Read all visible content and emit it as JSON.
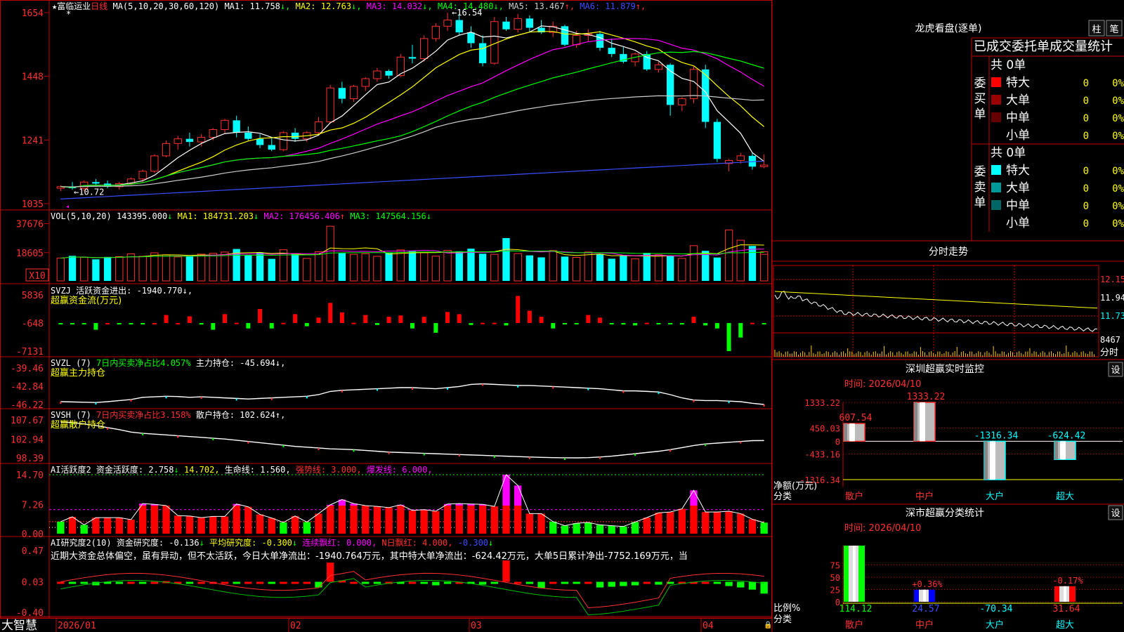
{
  "stock": {
    "name": "富临运业",
    "period": "日线",
    "ma_header": "MA(5,10,20,30,60,120)",
    "ma_values": [
      {
        "label": "MA1: 11.758",
        "arrow": "↓",
        "color": "#ffffff",
        "arrow_color": "#00ff00"
      },
      {
        "label": "MA2: 12.763",
        "arrow": "↓",
        "color": "#ffff00",
        "arrow_color": "#00ff00"
      },
      {
        "label": "MA3: 14.032",
        "arrow": "↓",
        "color": "#ff00ff",
        "arrow_color": "#00ff00"
      },
      {
        "label": "MA4: 14.480",
        "arrow": "↓",
        "color": "#00ff00",
        "arrow_color": "#00ff00"
      },
      {
        "label": "MA5: 13.467",
        "arrow": "↑",
        "color": "#cccccc",
        "arrow_color": "#ff3030"
      },
      {
        "label": "MA6: 11.879",
        "arrow": "↑",
        "color": "#3a4dff",
        "arrow_color": "#ff3030"
      }
    ],
    "high_label": "16.54",
    "low_label": "10.72"
  },
  "axes": {
    "main": [
      "1654",
      "1448",
      "1241",
      "1035"
    ],
    "vol": [
      "37676",
      "18605"
    ],
    "vol_unit": "X10",
    "svzj": [
      "5836",
      "-648",
      "-7131"
    ],
    "svzl": [
      "-39.46",
      "-42.84",
      "-46.22"
    ],
    "svsh": [
      "107.67",
      "102.94",
      "98.39"
    ],
    "ai1": [
      "14.70",
      "7.26",
      "0.00"
    ],
    "ai2": [
      "0.47",
      "0.03",
      "-0.40"
    ],
    "dates": [
      "2026/01",
      "02",
      "03",
      "04"
    ]
  },
  "panels": {
    "vol": {
      "header": "VOL(5,10,20)",
      "parts": [
        {
          "t": "143395.000",
          "c": "#ffffff",
          "a": "↓",
          "ac": "#00ff00"
        },
        {
          "t": "MA1: 184731.203",
          "c": "#ffff00",
          "a": "↓",
          "ac": "#00ff00"
        },
        {
          "t": "MA2: 176456.406",
          "c": "#ff00ff",
          "a": "↑",
          "ac": "#ff3030"
        },
        {
          "t": "MA3: 147564.156",
          "c": "#00ff00",
          "a": "↓",
          "ac": "#00ff00"
        }
      ]
    },
    "svzj": {
      "header": "SVZJ",
      "label": "活跃资金进出: -1940.770↓,",
      "sub": "超赢资金流(万元)"
    },
    "svzl": {
      "header": "SVZL (7)",
      "label1": "7日内买卖净占比4.057%",
      "label2": "主力持仓: -45.694↓,",
      "sub": "超赢主力持仓"
    },
    "svsh": {
      "header": "SVSH (7)",
      "label1": "7日内买卖净占比3.158%",
      "label2": "散户持仓: 102.624↑,",
      "sub": "超赢散户持仓"
    },
    "ai1": {
      "header": "AI活跃度2",
      "parts": [
        {
          "t": "资金活跃度: 2.758",
          "c": "#ffffff",
          "a": "↓",
          "ac": "#00ff00"
        },
        {
          "t": "14.702,",
          "c": "#ffff00",
          "a": "",
          "ac": ""
        },
        {
          "t": "生命线: 1.560,",
          "c": "#ffffff",
          "a": "",
          "ac": ""
        },
        {
          "t": "强势线: 3.000,",
          "c": "#ff3030",
          "a": "",
          "ac": ""
        },
        {
          "t": "爆发线: 6.000,",
          "c": "#ff00ff",
          "a": "",
          "ac": ""
        }
      ]
    },
    "ai2": {
      "header": "AI研究度2(10)",
      "parts": [
        {
          "t": "资金研究度: -0.136",
          "c": "#ffffff",
          "a": "↓",
          "ac": "#00ff00"
        },
        {
          "t": "平均研究度: -0.300",
          "c": "#ffff00",
          "a": "↓",
          "ac": "#00ff00"
        },
        {
          "t": "连续飘红: 0.000,",
          "c": "#ff00ff",
          "a": "",
          "ac": ""
        },
        {
          "t": "N日飘红: 4.000,",
          "c": "#ff3030",
          "a": "",
          "ac": ""
        },
        {
          "t": "-0.300",
          "c": "#3a4dff",
          "a": "↓",
          "ac": "#00ff00"
        }
      ],
      "commentary": "近期大资金总体偏空，虽有异动，但不太活跃，今日大单净流出：-1940.764万元，其中特大单净流出：-624.42万元，大单5日累计净出-7752.169万元，当"
    }
  },
  "footer": {
    "brand": "大智慧"
  },
  "dragon": {
    "title": "龙虎看盘(逐单)",
    "btn_bar": "柱",
    "btn_pen": "笔",
    "sub_title": "已成交委托单成交量统计",
    "buy_label": "委买单",
    "sell_label": "委卖单",
    "buy_total": "共 0单",
    "sell_total": "共 0单",
    "buy_rows": [
      {
        "name": "特大",
        "n": "0",
        "p": "0%",
        "color": "#ff0000"
      },
      {
        "name": "大单",
        "n": "0",
        "p": "0%",
        "color": "#990000"
      },
      {
        "name": "中单",
        "n": "0",
        "p": "0%",
        "color": "#660000"
      },
      {
        "name": "小单",
        "n": "0",
        "p": "0%",
        "color": ""
      }
    ],
    "sell_rows": [
      {
        "name": "特大",
        "n": "0",
        "p": "0%",
        "color": "#00ffff"
      },
      {
        "name": "大单",
        "n": "0",
        "p": "0%",
        "color": "#009999"
      },
      {
        "name": "中单",
        "n": "0",
        "p": "0%",
        "color": "#006666"
      },
      {
        "name": "小单",
        "n": "0",
        "p": "0%",
        "color": ""
      }
    ]
  },
  "intraday": {
    "title": "分时走势",
    "prices": [
      "12.15",
      "11.94",
      "11.73"
    ],
    "vol": "8467",
    "vol_label": "分时"
  },
  "monitor": {
    "title": "深圳超赢实时监控",
    "btn": "设",
    "time": "时间: 2026/04/10",
    "y_labels": [
      "1333.22",
      "450.03",
      "0",
      "-433.16",
      "-1316.34"
    ],
    "unit_label": "净额(万元)",
    "cat_label": "分类",
    "bars": [
      {
        "cat": "散户",
        "value": 607.54,
        "label": "607.54"
      },
      {
        "cat": "中户",
        "value": 1333.22,
        "label": "1333.22"
      },
      {
        "cat": "大户",
        "value": -1316.34,
        "label": "-1316.34"
      },
      {
        "cat": "超大",
        "value": -624.42,
        "label": "-624.42"
      }
    ]
  },
  "classify": {
    "title": "深市超赢分类统计",
    "btn": "设",
    "time": "时间: 2026/04/10",
    "y_labels": [
      "75",
      "50",
      "25",
      "0"
    ],
    "unit_label": "比例%",
    "cat_label": "分类",
    "bars": [
      {
        "cat": "散户",
        "value": 114.12,
        "top": "",
        "bottom": "114.12"
      },
      {
        "cat": "中户",
        "value": 24.57,
        "top": "+0.36%",
        "bottom": "24.57"
      },
      {
        "cat": "大户",
        "value": -70.34,
        "top": "",
        "bottom": "-70.34"
      },
      {
        "cat": "超大",
        "value": 31.64,
        "top": "-0.17%",
        "bottom": "31.64"
      }
    ]
  },
  "chart_data": {
    "type": "candlestick",
    "title": "富临运业 日线",
    "ylim": [
      10.35,
      16.54
    ],
    "x": [
      "2026/01",
      "02",
      "03",
      "04"
    ],
    "ohlc": [
      [
        10.85,
        10.95,
        10.75,
        10.9
      ],
      [
        10.9,
        11.05,
        10.8,
        10.85
      ],
      [
        10.85,
        11.1,
        10.75,
        11.05
      ],
      [
        11.05,
        11.15,
        10.95,
        11.0
      ],
      [
        11.0,
        11.1,
        10.85,
        10.9
      ],
      [
        10.9,
        11.05,
        10.8,
        11.0
      ],
      [
        11.0,
        11.2,
        10.95,
        11.15
      ],
      [
        11.15,
        11.45,
        11.05,
        11.4
      ],
      [
        11.4,
        11.95,
        11.35,
        11.9
      ],
      [
        11.9,
        12.4,
        11.85,
        12.3
      ],
      [
        12.3,
        12.55,
        12.1,
        12.45
      ],
      [
        12.45,
        12.65,
        12.2,
        12.35
      ],
      [
        12.35,
        12.6,
        12.2,
        12.5
      ],
      [
        12.5,
        12.8,
        12.4,
        12.75
      ],
      [
        12.75,
        13.1,
        12.6,
        13.05
      ],
      [
        13.05,
        13.2,
        12.5,
        12.65
      ],
      [
        12.65,
        12.85,
        12.4,
        12.45
      ],
      [
        12.45,
        12.6,
        12.15,
        12.25
      ],
      [
        12.25,
        12.5,
        12.05,
        12.1
      ],
      [
        12.1,
        12.7,
        12.05,
        12.65
      ],
      [
        12.65,
        12.8,
        12.35,
        12.45
      ],
      [
        12.45,
        12.7,
        12.35,
        12.65
      ],
      [
        12.65,
        13.15,
        12.6,
        13.0
      ],
      [
        13.0,
        14.2,
        12.95,
        14.1
      ],
      [
        14.1,
        14.3,
        13.6,
        13.75
      ],
      [
        13.75,
        14.2,
        13.65,
        14.15
      ],
      [
        14.15,
        14.45,
        14.0,
        14.4
      ],
      [
        14.4,
        14.75,
        14.3,
        14.65
      ],
      [
        14.65,
        14.7,
        14.4,
        14.5
      ],
      [
        14.5,
        15.2,
        14.45,
        15.1
      ],
      [
        15.1,
        15.5,
        14.9,
        15.05
      ],
      [
        15.05,
        15.8,
        14.95,
        15.7
      ],
      [
        15.7,
        16.2,
        15.6,
        16.1
      ],
      [
        16.1,
        16.54,
        15.95,
        16.3
      ],
      [
        16.3,
        16.5,
        15.8,
        15.9
      ],
      [
        15.9,
        16.1,
        15.4,
        15.55
      ],
      [
        15.55,
        15.8,
        14.8,
        14.9
      ],
      [
        14.9,
        16.4,
        14.85,
        16.25
      ],
      [
        16.25,
        16.4,
        15.95,
        16.0
      ],
      [
        16.0,
        16.5,
        15.9,
        16.35
      ],
      [
        16.35,
        16.45,
        15.9,
        16.05
      ],
      [
        16.05,
        16.3,
        15.85,
        15.9
      ],
      [
        15.9,
        16.25,
        15.75,
        16.1
      ],
      [
        16.1,
        16.15,
        15.45,
        15.5
      ],
      [
        15.5,
        15.95,
        15.4,
        15.8
      ],
      [
        15.8,
        16.0,
        15.6,
        15.85
      ],
      [
        15.85,
        15.95,
        15.3,
        15.4
      ],
      [
        15.4,
        15.7,
        15.1,
        15.2
      ],
      [
        15.2,
        15.45,
        14.9,
        14.95
      ],
      [
        14.95,
        15.25,
        14.8,
        15.2
      ],
      [
        15.2,
        15.3,
        14.65,
        14.7
      ],
      [
        14.7,
        14.95,
        14.6,
        14.85
      ],
      [
        14.85,
        14.9,
        13.2,
        13.55
      ],
      [
        13.55,
        13.8,
        13.35,
        13.75
      ],
      [
        13.75,
        14.8,
        13.6,
        14.7
      ],
      [
        14.7,
        14.85,
        12.8,
        13.0
      ],
      [
        13.0,
        13.1,
        11.7,
        11.8
      ],
      [
        11.65,
        11.8,
        11.4,
        11.75
      ],
      [
        11.75,
        12.0,
        11.65,
        11.9
      ],
      [
        11.9,
        12.0,
        11.45,
        11.55
      ],
      [
        11.55,
        11.95,
        11.5,
        11.6
      ]
    ],
    "vol": [
      15000,
      16500,
      15500,
      14200,
      15800,
      16000,
      17800,
      16200,
      18500,
      17200,
      15800,
      16200,
      17600,
      18200,
      19000,
      21000,
      17000,
      18600,
      14500,
      20500,
      17800,
      14800,
      19200,
      36000,
      18200,
      17500,
      17900,
      16200,
      18400,
      20400,
      19600,
      18500,
      16300,
      20100,
      19500,
      21200,
      17900,
      17500,
      28200,
      18000,
      16800,
      15500,
      20000,
      16000,
      15500,
      19000,
      17800,
      14600,
      16400,
      14500,
      18500,
      17200,
      16400,
      14800,
      23200,
      19800,
      15400,
      33500,
      26800,
      23000,
      19200,
      17500
    ],
    "svzj": [
      -648,
      -650,
      -648,
      -2200,
      -640,
      -648,
      -650,
      -648,
      -645,
      1200,
      -640,
      900,
      -1000,
      -2200,
      1400,
      -600,
      -1900,
      2600,
      -1900,
      -600,
      1400,
      -1400,
      600,
      4000,
      1800,
      -600,
      1200,
      -1100,
      800,
      1100,
      -1900,
      800,
      -2900,
      1900,
      1400,
      -1100,
      -600,
      -600,
      -1200,
      5600,
      2200,
      800,
      -1900,
      -800,
      -650,
      1200,
      600,
      -648,
      -1000,
      -1200,
      -600,
      -800,
      -650,
      -1000,
      800,
      -1200,
      -1900,
      -7131,
      -4000,
      -600,
      -648,
      -2100
    ],
    "svzl": [
      -45.7,
      -45.75,
      -45.8,
      -45.85,
      -45.7,
      -45.5,
      -45.3,
      -44.9,
      -44.8,
      -44.7,
      -44.75,
      -44.9,
      -44.8,
      -44.9,
      -45.0,
      -45.1,
      -45.2,
      -45.1,
      -45.0,
      -44.9,
      -44.8,
      -44.7,
      -44.4,
      -43.8,
      -43.6,
      -43.5,
      -43.4,
      -43.3,
      -43.2,
      -43.1,
      -43.1,
      -43.2,
      -43.3,
      -43.1,
      -42.9,
      -42.5,
      -42.4,
      -42.5,
      -42.6,
      -42.7,
      -42.7,
      -42.8,
      -42.9,
      -43.0,
      -43.1,
      -43.2,
      -43.3,
      -43.5,
      -43.7,
      -43.7,
      -43.8,
      -43.9,
      -44.4,
      -45.0,
      -45.4,
      -45.5,
      -45.5,
      -45.6,
      -45.7,
      -46.0,
      -46.22
    ],
    "svsh": [
      107.2,
      107.0,
      106.7,
      106.3,
      105.8,
      105.3,
      104.7,
      104.4,
      104.2,
      104.0,
      103.8,
      103.6,
      103.4,
      103.2,
      103.0,
      102.7,
      102.4,
      102.1,
      101.8,
      101.5,
      101.2,
      101.0,
      100.8,
      100.6,
      100.5,
      100.4,
      100.2,
      100.0,
      99.8,
      99.7,
      99.6,
      99.5,
      99.4,
      99.3,
      99.2,
      99.1,
      99.0,
      98.9,
      98.8,
      98.7,
      98.6,
      98.5,
      98.45,
      98.4,
      98.39,
      98.45,
      98.6,
      98.8,
      99.1,
      99.4,
      99.7,
      100.0,
      100.4,
      100.9,
      101.4,
      101.8,
      102.0,
      102.2,
      102.4,
      102.6,
      102.62
    ],
    "ai1": [
      3.0,
      4.2,
      2.2,
      4.0,
      4.0,
      4.0,
      3.5,
      7.5,
      7.3,
      7.0,
      4.5,
      4.4,
      4.0,
      4.3,
      4.3,
      7.4,
      6.7,
      4.8,
      3.9,
      2.8,
      4.4,
      2.9,
      5.0,
      7.2,
      8.5,
      7.5,
      7.0,
      6.8,
      6.5,
      7.2,
      5.8,
      6.0,
      5.6,
      7.4,
      7.5,
      7.4,
      7.3,
      6.8,
      14.7,
      12.0,
      5.0,
      5.0,
      3.0,
      2.0,
      2.6,
      2.8,
      2.2,
      2.0,
      1.8,
      2.9,
      4.0,
      5.2,
      5.4,
      6.2,
      10.8,
      5.4,
      5.4,
      5.6,
      5.0,
      3.6,
      2.758
    ],
    "ai2": [
      0.02,
      0.0,
      0.01,
      -0.02,
      0.01,
      0.0,
      0.02,
      0.01,
      0.03,
      0.04,
      0.02,
      0.01,
      0.03,
      0.02,
      0.03,
      0.01,
      0.03,
      0.02,
      0.01,
      0.02,
      0.03,
      0.02,
      -0.05,
      0.3,
      0.05,
      0.02,
      0.01,
      0.0,
      0.03,
      0.01,
      0.02,
      0.0,
      -0.02,
      0.01,
      0.02,
      0.0,
      -0.01,
      0.01,
      0.33,
      0.02,
      0.0,
      -0.06,
      0.02,
      0.0,
      0.01,
      0.02,
      -0.05,
      -0.04,
      -0.03,
      -0.02,
      0.02,
      -0.01,
      0.0,
      0.03,
      0.02,
      0.02,
      0.01,
      -0.03,
      -0.05,
      -0.08,
      -0.136
    ]
  }
}
